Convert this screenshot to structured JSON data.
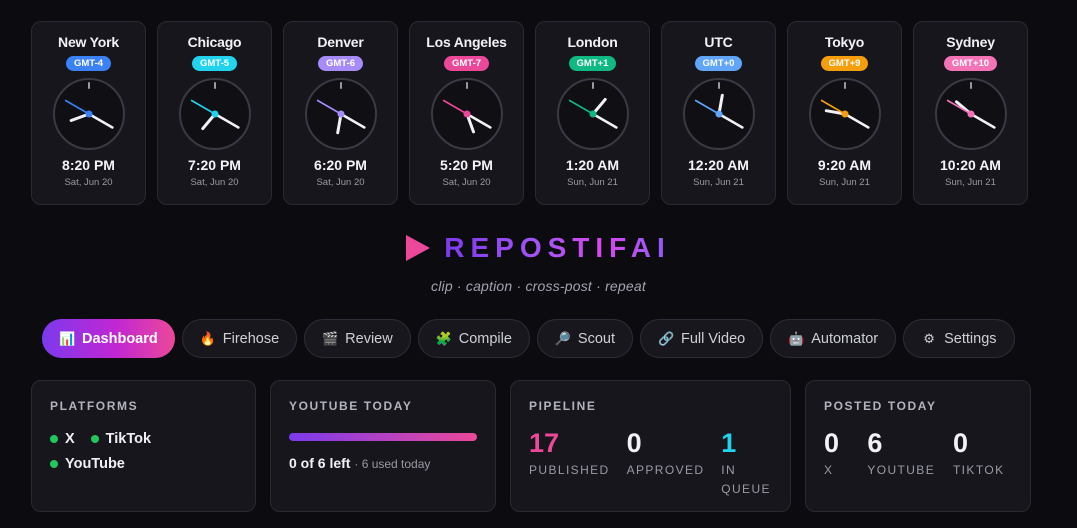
{
  "clocks": [
    {
      "city": "New York",
      "gmt": "GMT-4",
      "color": "#3b82f6",
      "time": "8:20 PM",
      "date": "Sat, Jun 20",
      "hour": 20,
      "minute": 20
    },
    {
      "city": "Chicago",
      "gmt": "GMT-5",
      "color": "#22d3ee",
      "time": "7:20 PM",
      "date": "Sat, Jun 20",
      "hour": 19,
      "minute": 20
    },
    {
      "city": "Denver",
      "gmt": "GMT-6",
      "color": "#a78bfa",
      "time": "6:20 PM",
      "date": "Sat, Jun 20",
      "hour": 18,
      "minute": 20
    },
    {
      "city": "Los Angeles",
      "gmt": "GMT-7",
      "color": "#ec4899",
      "time": "5:20 PM",
      "date": "Sat, Jun 20",
      "hour": 17,
      "minute": 20
    },
    {
      "city": "London",
      "gmt": "GMT+1",
      "color": "#10b981",
      "time": "1:20 AM",
      "date": "Sun, Jun 21",
      "hour": 1,
      "minute": 20
    },
    {
      "city": "UTC",
      "gmt": "GMT+0",
      "color": "#60a5fa",
      "time": "12:20 AM",
      "date": "Sun, Jun 21",
      "hour": 0,
      "minute": 20
    },
    {
      "city": "Tokyo",
      "gmt": "GMT+9",
      "color": "#f59e0b",
      "time": "9:20 AM",
      "date": "Sun, Jun 21",
      "hour": 9,
      "minute": 20
    },
    {
      "city": "Sydney",
      "gmt": "GMT+10",
      "color": "#f472b6",
      "time": "10:20 AM",
      "date": "Sun, Jun 21",
      "hour": 10,
      "minute": 20
    }
  ],
  "brand": {
    "name": "REPOSTIFAI",
    "tagline": "clip · caption · cross-post · repeat",
    "icon": "play-icon",
    "accent": "#ec4899"
  },
  "nav": [
    {
      "label": "Dashboard",
      "icon": "📊",
      "active": true
    },
    {
      "label": "Firehose",
      "icon": "🔥",
      "active": false
    },
    {
      "label": "Review",
      "icon": "🎬",
      "active": false
    },
    {
      "label": "Compile",
      "icon": "🧩",
      "active": false
    },
    {
      "label": "Scout",
      "icon": "🔎",
      "active": false
    },
    {
      "label": "Full Video",
      "icon": "🔗",
      "active": false
    },
    {
      "label": "Automator",
      "icon": "🤖",
      "active": false
    },
    {
      "label": "Settings",
      "icon": "⚙",
      "active": false
    }
  ],
  "platforms": {
    "title": "PLATFORMS",
    "items": [
      "X",
      "TikTok",
      "YouTube"
    ]
  },
  "youtube_today": {
    "title": "YOUTUBE TODAY",
    "left_text": "0 of 6 left",
    "used_text": "· 6 used today",
    "used_fraction": 1.0
  },
  "pipeline": {
    "title": "PIPELINE",
    "metrics": [
      {
        "value": "17",
        "label": "PUBLISHED",
        "color": "#ec4899"
      },
      {
        "value": "0",
        "label": "APPROVED",
        "color": "#f2f2f6"
      },
      {
        "value": "1",
        "label": "IN QUEUE",
        "color": "#22d3ee"
      }
    ]
  },
  "posted_today": {
    "title": "POSTED TODAY",
    "metrics": [
      {
        "value": "0",
        "label": "X"
      },
      {
        "value": "6",
        "label": "YOUTUBE"
      },
      {
        "value": "0",
        "label": "TIKTOK"
      }
    ]
  }
}
